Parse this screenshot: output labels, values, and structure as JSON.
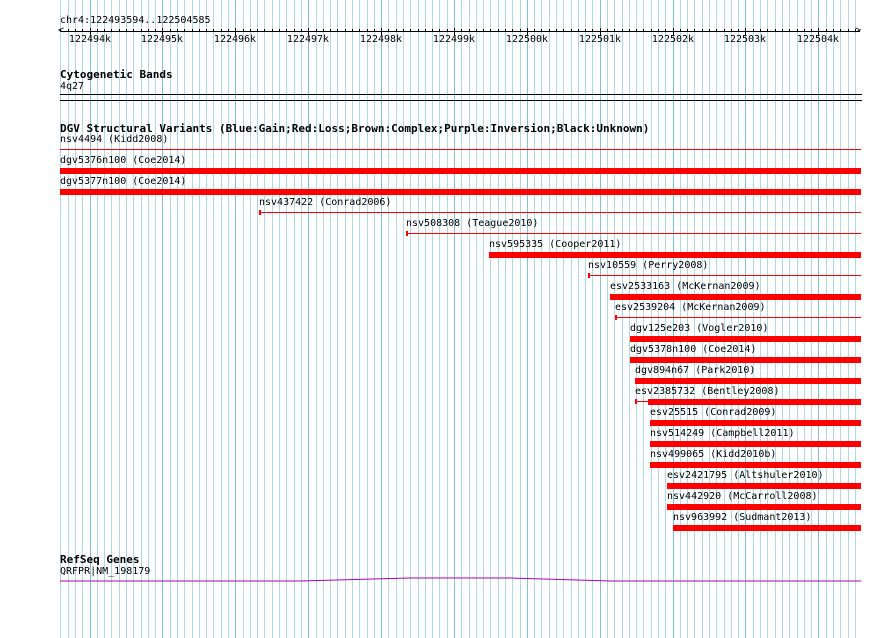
{
  "ruler": {
    "locus": "chr4:122493594..122504585",
    "start": 122493594,
    "end": 122504585,
    "ticks": [
      "122494k",
      "122495k",
      "122496k",
      "122497k",
      "122498k",
      "122499k",
      "122500k",
      "122501k",
      "122502k",
      "122503k",
      "122504k"
    ]
  },
  "cytoband": {
    "title": "Cytogenetic Bands",
    "band": "4q27"
  },
  "dgv": {
    "title": "DGV Structural Variants (Blue:Gain;Red:Loss;Brown:Complex;Purple:Inversion;Black:Unknown)",
    "color": "#ff0000",
    "variants": [
      {
        "label": "nsv4494 (Kidd2008)",
        "start": 122493594,
        "end": 122504585,
        "style": "thin"
      },
      {
        "label": "dgv5376n100 (Coe2014)",
        "start": 122493594,
        "end": 122504585,
        "style": "thick"
      },
      {
        "label": "dgv5377n100 (Coe2014)",
        "start": 122493594,
        "end": 122504585,
        "style": "thick"
      },
      {
        "label": "nsv437422 (Conrad2006)",
        "start": 122496330,
        "end": 122504585,
        "style": "thin"
      },
      {
        "label": "nsv508308 (Teague2010)",
        "start": 122498340,
        "end": 122504585,
        "style": "thin"
      },
      {
        "label": "nsv595335 (Cooper2011)",
        "start": 122499480,
        "end": 122504585,
        "style": "thick"
      },
      {
        "label": "nsv10559 (Perry2008)",
        "start": 122500840,
        "end": 122504585,
        "style": "thin"
      },
      {
        "label": "esv2533163 (McKernan2009)",
        "start": 122501140,
        "end": 122504585,
        "style": "thick"
      },
      {
        "label": "esv2539204 (McKernan2009)",
        "start": 122501210,
        "end": 122504585,
        "style": "thin"
      },
      {
        "label": "dgv125e203 (Vogler2010)",
        "start": 122501420,
        "end": 122504585,
        "style": "thick"
      },
      {
        "label": "dgv5378n100 (Coe2014)",
        "start": 122501420,
        "end": 122504585,
        "style": "thick"
      },
      {
        "label": "dgv894n67 (Park2010)",
        "start": 122501490,
        "end": 122504585,
        "style": "thick"
      },
      {
        "label": "esv2385732 (Bentley2008)",
        "start": 122501490,
        "end": 122504585,
        "style": "mixed"
      },
      {
        "label": "esv25515 (Conrad2009)",
        "start": 122501690,
        "end": 122504585,
        "style": "thick"
      },
      {
        "label": "nsv514249 (Campbell2011)",
        "start": 122501690,
        "end": 122504585,
        "style": "thick"
      },
      {
        "label": "nsv499065 (Kidd2010b)",
        "start": 122501690,
        "end": 122504585,
        "style": "thick"
      },
      {
        "label": "esv2421795 (Altshuler2010)",
        "start": 122501920,
        "end": 122504585,
        "style": "thick"
      },
      {
        "label": "nsv442920 (McCarroll2008)",
        "start": 122501920,
        "end": 122504585,
        "style": "thick"
      },
      {
        "label": "nsv963992 (Sudmant2013)",
        "start": 122502010,
        "end": 122504585,
        "style": "thick"
      }
    ]
  },
  "refseq": {
    "title": "RefSeq Genes",
    "gene": "QRFPR|NM_198179",
    "color": "#b000b0"
  }
}
